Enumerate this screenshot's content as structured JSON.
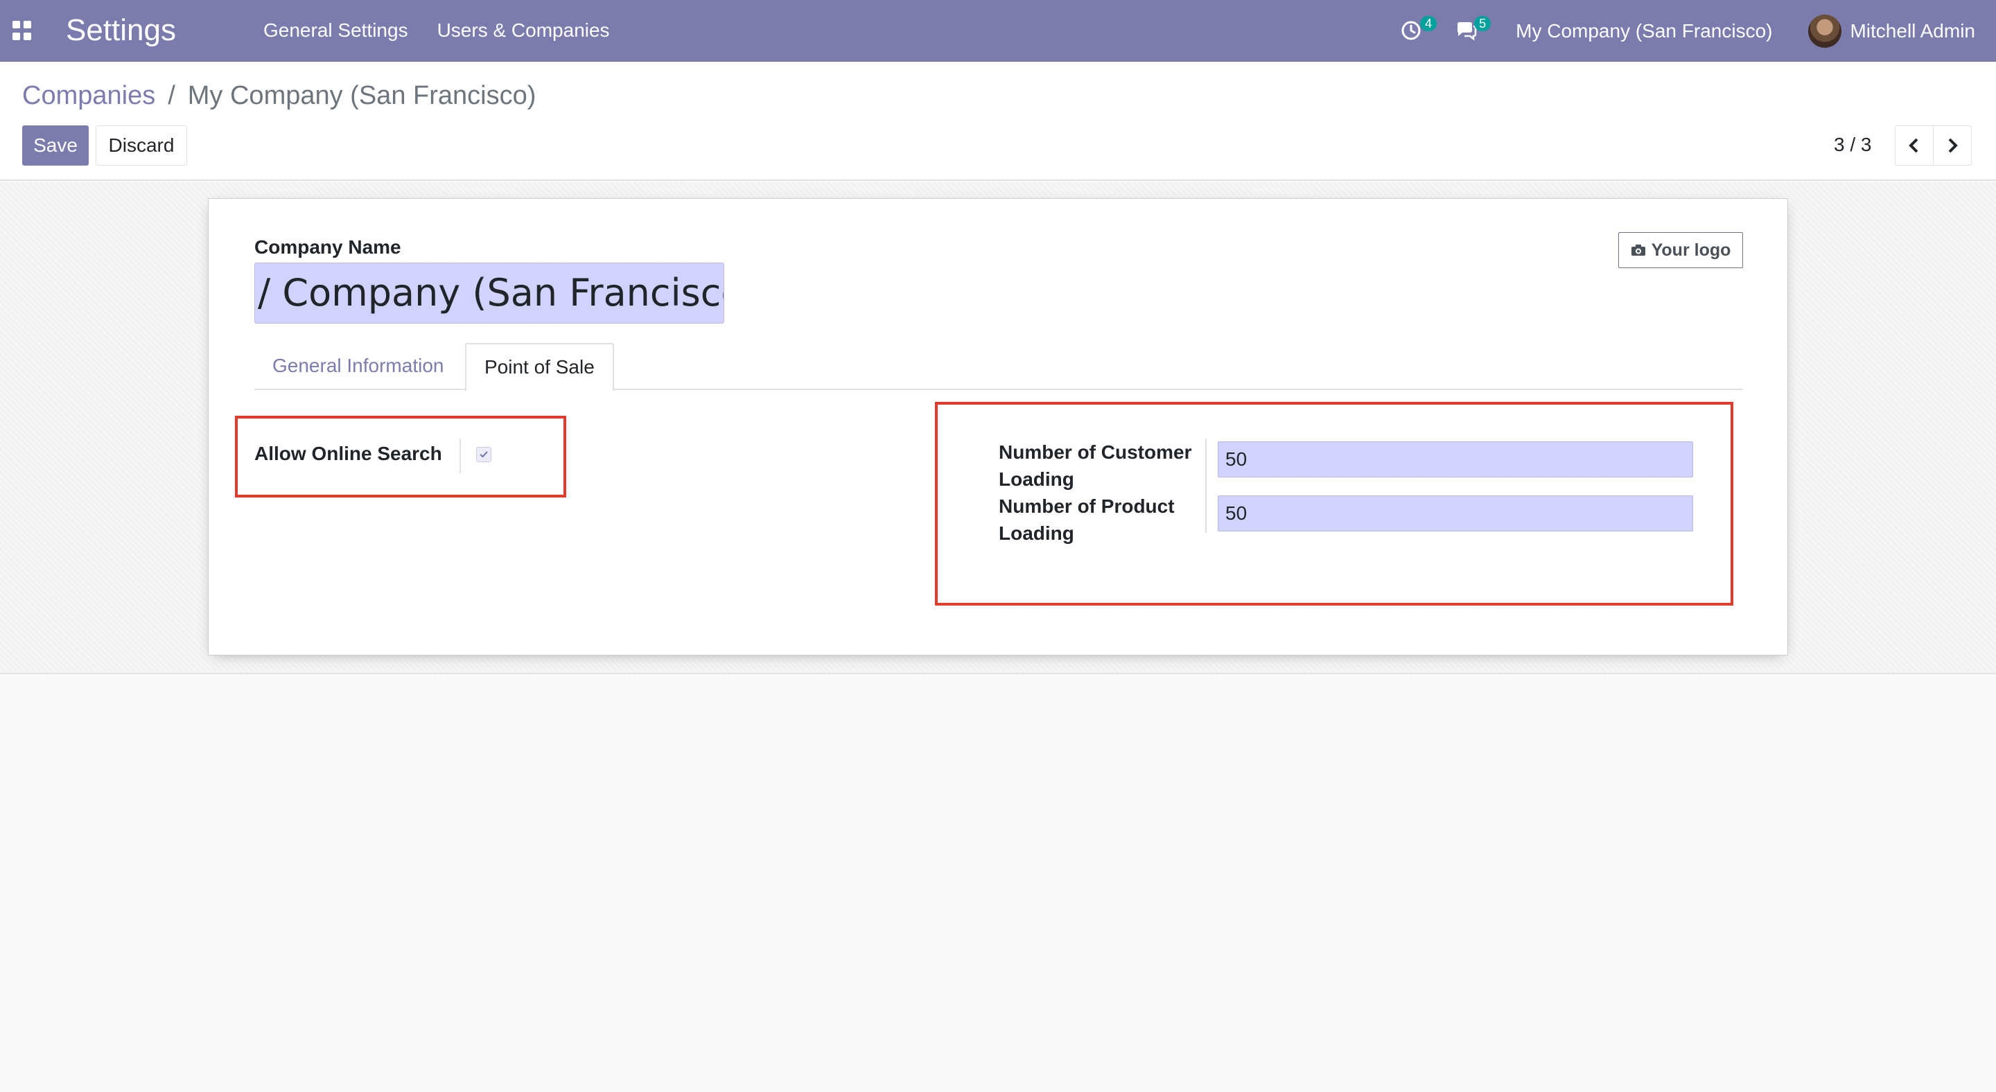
{
  "navbar": {
    "app_title": "Settings",
    "menu": [
      "General Settings",
      "Users & Companies"
    ],
    "activity_count": "4",
    "message_count": "5",
    "company": "My Company (San Francisco)",
    "user": "Mitchell Admin"
  },
  "breadcrumb": {
    "parent": "Companies",
    "separator": "/",
    "current": "My Company (San Francisco)"
  },
  "buttons": {
    "save": "Save",
    "discard": "Discard"
  },
  "pager": {
    "value": "3 / 3"
  },
  "form": {
    "company_name_label": "Company Name",
    "company_name_value": "/ Company (San Francisco)",
    "logo_button": "Your logo",
    "tabs": [
      "General Information",
      "Point of Sale"
    ],
    "active_tab": "Point of Sale",
    "allow_online_search_label": "Allow Online Search",
    "allow_online_search_checked": true,
    "customer_loading_label": "Number of Customer Loading",
    "customer_loading_value": "50",
    "product_loading_label": "Number of Product Loading",
    "product_loading_value": "50"
  },
  "colors": {
    "brand": "#7c7bad",
    "badge": "#00a09d",
    "highlight_box": "#e23a2b",
    "input_bg": "#d2d2ff"
  }
}
